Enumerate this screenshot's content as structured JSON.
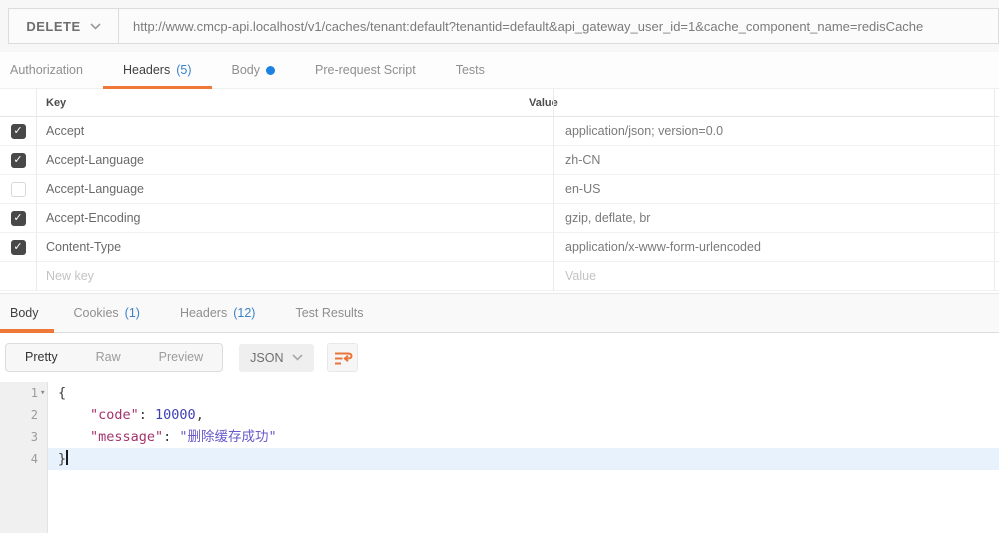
{
  "request": {
    "method": "DELETE",
    "url": "http://www.cmcp-api.localhost/v1/caches/tenant:default?tenantid=default&api_gateway_user_id=1&cache_component_name=redisCache",
    "tabs": [
      {
        "label": "Authorization"
      },
      {
        "label": "Headers",
        "count": "(5)",
        "active": true
      },
      {
        "label": "Body",
        "modified_dot": true
      },
      {
        "label": "Pre-request Script"
      },
      {
        "label": "Tests"
      }
    ]
  },
  "headers_table": {
    "columns": {
      "key": "Key",
      "value": "Value"
    },
    "rows": [
      {
        "checked": true,
        "key": "Accept",
        "value": "application/json; version=0.0"
      },
      {
        "checked": true,
        "key": "Accept-Language",
        "value": "zh-CN"
      },
      {
        "checked": false,
        "key": "Accept-Language",
        "value": "en-US"
      },
      {
        "checked": true,
        "key": "Accept-Encoding",
        "value": "gzip, deflate, br"
      },
      {
        "checked": true,
        "key": "Content-Type",
        "value": "application/x-www-form-urlencoded"
      }
    ],
    "new_row": {
      "key_placeholder": "New key",
      "value_placeholder": "Value"
    }
  },
  "response": {
    "tabs": [
      {
        "label": "Body",
        "active": true
      },
      {
        "label": "Cookies",
        "count": "(1)"
      },
      {
        "label": "Headers",
        "count": "(12)"
      },
      {
        "label": "Test Results"
      }
    ],
    "view_modes": {
      "pretty": "Pretty",
      "raw": "Raw",
      "preview": "Preview",
      "active": "Pretty"
    },
    "format_select": "JSON",
    "icons": {
      "method_chevron": "chevron-down",
      "format_chevron": "chevron-down",
      "wrap_button": "wrap-text",
      "fold_caret": "collapse-triangle"
    },
    "body": {
      "line_numbers": [
        "1",
        "2",
        "3",
        "4"
      ],
      "line1": {
        "brace": "{"
      },
      "line2": {
        "key": "\"code\"",
        "colon": ": ",
        "number": "10000",
        "comma": ","
      },
      "line3": {
        "key": "\"message\"",
        "colon": ": ",
        "string": "\"删除缓存成功\""
      },
      "line4": {
        "brace": "}"
      }
    }
  },
  "colors": {
    "accent_orange": "#ef7737",
    "count_blue": "#3b82c9",
    "modified_dot_blue": "#1a82e2",
    "active_line_bg": "#e8f2fc",
    "token_key": "#a5326b",
    "token_number": "#3f3fb5",
    "token_string": "#6a5acb"
  }
}
